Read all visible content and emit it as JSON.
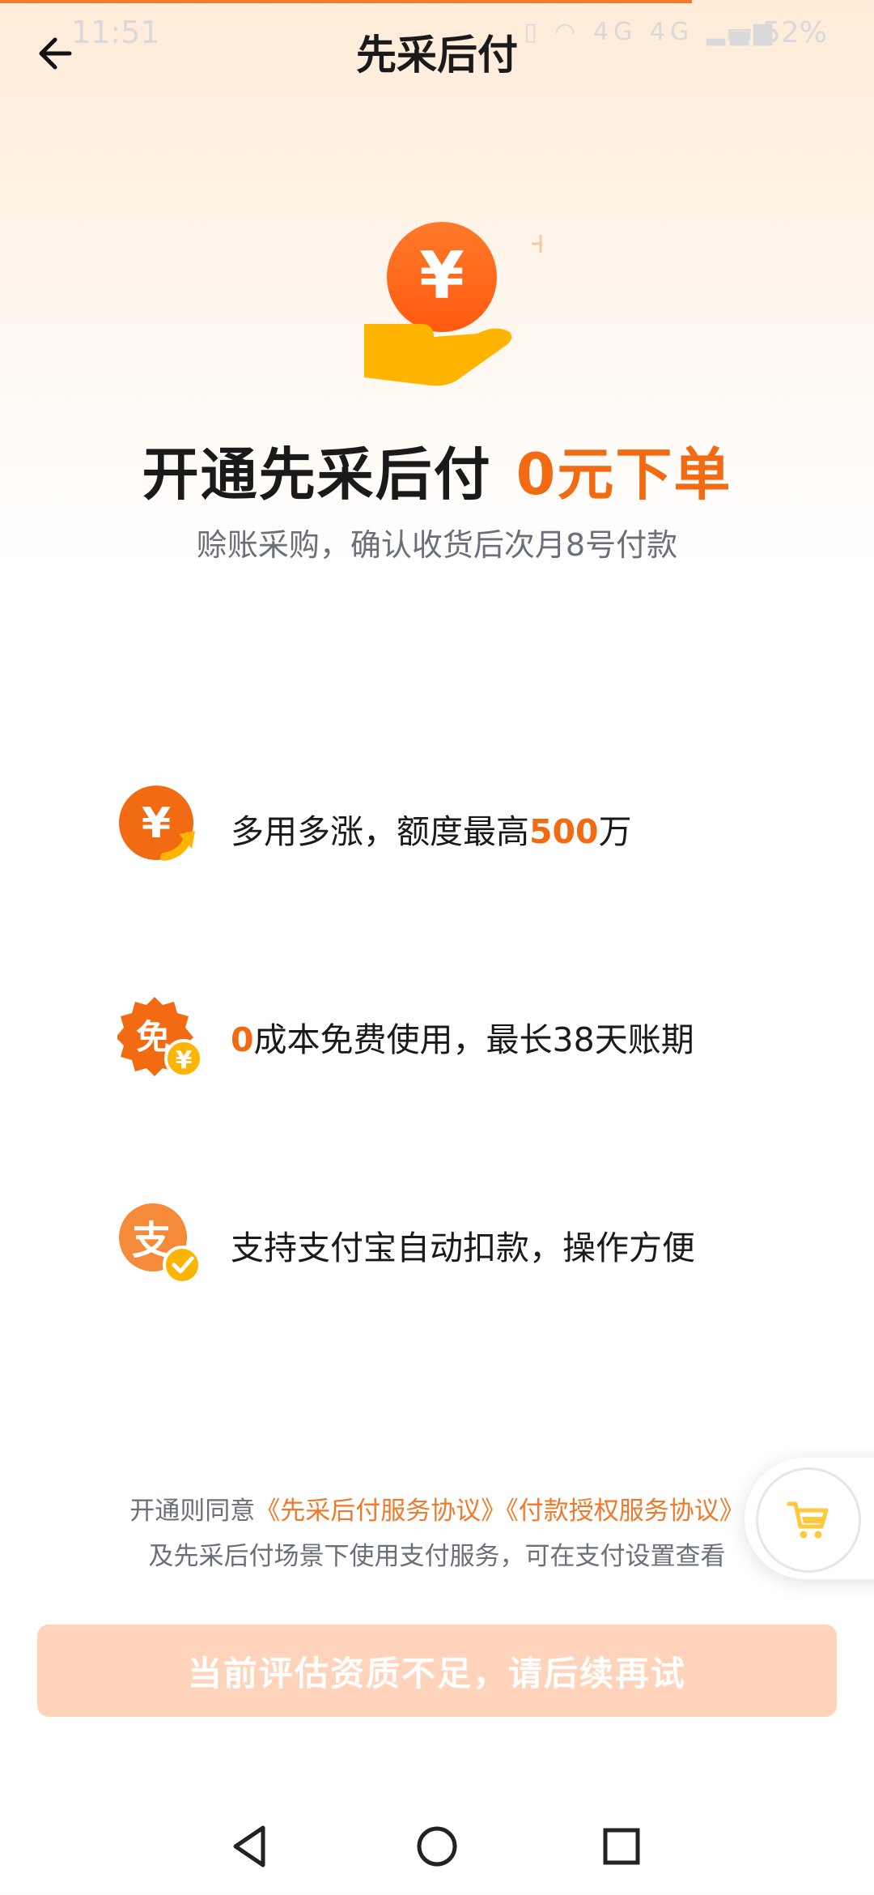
{
  "status_bar": {
    "time": "11:51",
    "network": "4G 4G",
    "battery": "52%"
  },
  "header": {
    "title": "先采后付"
  },
  "hero": {
    "title_prefix": "开通先采后付",
    "title_accent": "0元下单",
    "subtitle": "赊账采购，确认收货后次月8号付款"
  },
  "features": [
    {
      "icon": "yuan-up-icon",
      "before": "多用多涨，额度最高",
      "highlight": "500",
      "after": "万"
    },
    {
      "icon": "free-badge-icon",
      "before": "",
      "highlight": "0",
      "after": "成本免费使用，最长38天账期"
    },
    {
      "icon": "alipay-check-icon",
      "before": "支持支付宝自动扣款，操作方便",
      "highlight": "",
      "after": ""
    }
  ],
  "agreement": {
    "prefix": "开通则同意",
    "link1": "《先采后付服务协议》",
    "link2": "《付款授权服务协议》",
    "line2": "及先采后付场景下使用支付服务，可在支付设置查看"
  },
  "cta": {
    "label": "当前评估资质不足，请后续再试"
  },
  "colors": {
    "accent": "#F26A12",
    "cta_bg": "#FFD4BA",
    "link": "#F07A2B"
  }
}
